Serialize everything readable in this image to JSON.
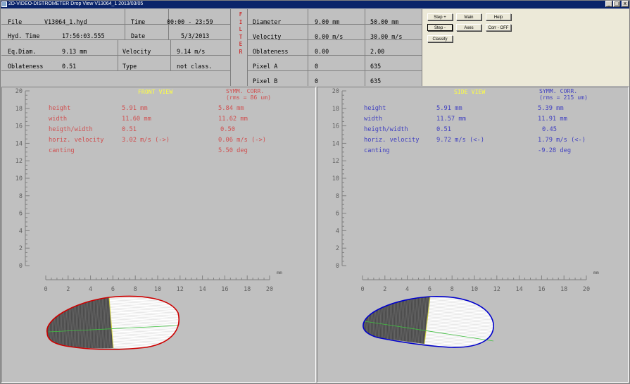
{
  "window": {
    "title": "2D-VIDEO-DISTROMETER   Drop View   V13064_1   2013/03/05",
    "min_glyph": "_",
    "max_glyph": "□",
    "close_glyph": "x"
  },
  "info": {
    "file_label": "File",
    "file_value": "V13064_1.hyd",
    "time_label": "Time",
    "time_value": "00:00 - 23:59",
    "hydtime_label": "Hyd. Time",
    "hydtime_value": "17:56:03.555",
    "date_label": "Date",
    "date_value": "5/3/2013",
    "eqdiam_label": "Eq.Diam.",
    "eqdiam_value": "9.13 mm",
    "velocity_label": "Velocity",
    "velocity_value": "9.14 m/s",
    "oblateness_label": "Oblateness",
    "oblateness_value": "0.51",
    "type_label": "Type",
    "type_value": "not class."
  },
  "filter": {
    "letters": [
      "F",
      "I",
      "L",
      "T",
      "E",
      "R"
    ],
    "rows": [
      {
        "label": "Diameter",
        "min": "9.00 mm",
        "max": "50.00 mm"
      },
      {
        "label": "Velocity",
        "min": "0.00 m/s",
        "max": "30.00 m/s"
      },
      {
        "label": "Oblateness",
        "min": "0.00",
        "max": "2.00"
      },
      {
        "label": "Pixel A",
        "min": "0",
        "max": "635"
      },
      {
        "label": "Pixel B",
        "min": "0",
        "max": "635"
      }
    ]
  },
  "controls": {
    "step_plus": "Step +",
    "step_minus": "Step -",
    "classify": "Classify",
    "main": "Main",
    "axes": "Axes",
    "help": "Help",
    "corr_off": "Corr - OFF"
  },
  "front_view": {
    "title": "FRONT VIEW",
    "symm_line1": "SYMM. CORR.",
    "symm_line2": "(rms = 86 um)",
    "color": "#d05050",
    "outline_color": "#cc0000",
    "stats": [
      {
        "label": "height",
        "value": "5.91 mm",
        "corr": "5.84 mm"
      },
      {
        "label": "width",
        "value": "11.60 mm",
        "corr": "11.62 mm"
      },
      {
        "label": "heigth/width",
        "value": "0.51",
        "corr": "0.50"
      },
      {
        "label": "horiz. velocity",
        "value": "3.02 m/s (->)",
        "corr": "0.06 m/s (->)"
      },
      {
        "label": "canting",
        "value": "",
        "corr": "5.50 deg"
      }
    ]
  },
  "side_view": {
    "title": "SIDE VIEW",
    "symm_line1": "SYMM. CORR.",
    "symm_line2": "(rms = 215 um)",
    "color": "#4040c0",
    "outline_color": "#0000cc",
    "stats": [
      {
        "label": "height",
        "value": "5.91 mm",
        "corr": "5.39 mm"
      },
      {
        "label": "width",
        "value": "11.57 mm",
        "corr": "11.91 mm"
      },
      {
        "label": "heigth/width",
        "value": "0.51",
        "corr": "0.45"
      },
      {
        "label": "horiz. velocity",
        "value": "9.72 m/s (<-)",
        "corr": "1.79 m/s (<-)"
      },
      {
        "label": "canting",
        "value": "",
        "corr": "-9.28 deg"
      }
    ]
  },
  "axes": {
    "unit": "mm",
    "ticks": [
      "0",
      "2",
      "4",
      "6",
      "8",
      "10",
      "12",
      "14",
      "16",
      "18",
      "20"
    ],
    "range": [
      0,
      20
    ]
  },
  "colors": {
    "yellow": "#ffff40",
    "outline_front": "#cc0000",
    "outline_side": "#0000cc",
    "axis_green": "#40c040"
  }
}
